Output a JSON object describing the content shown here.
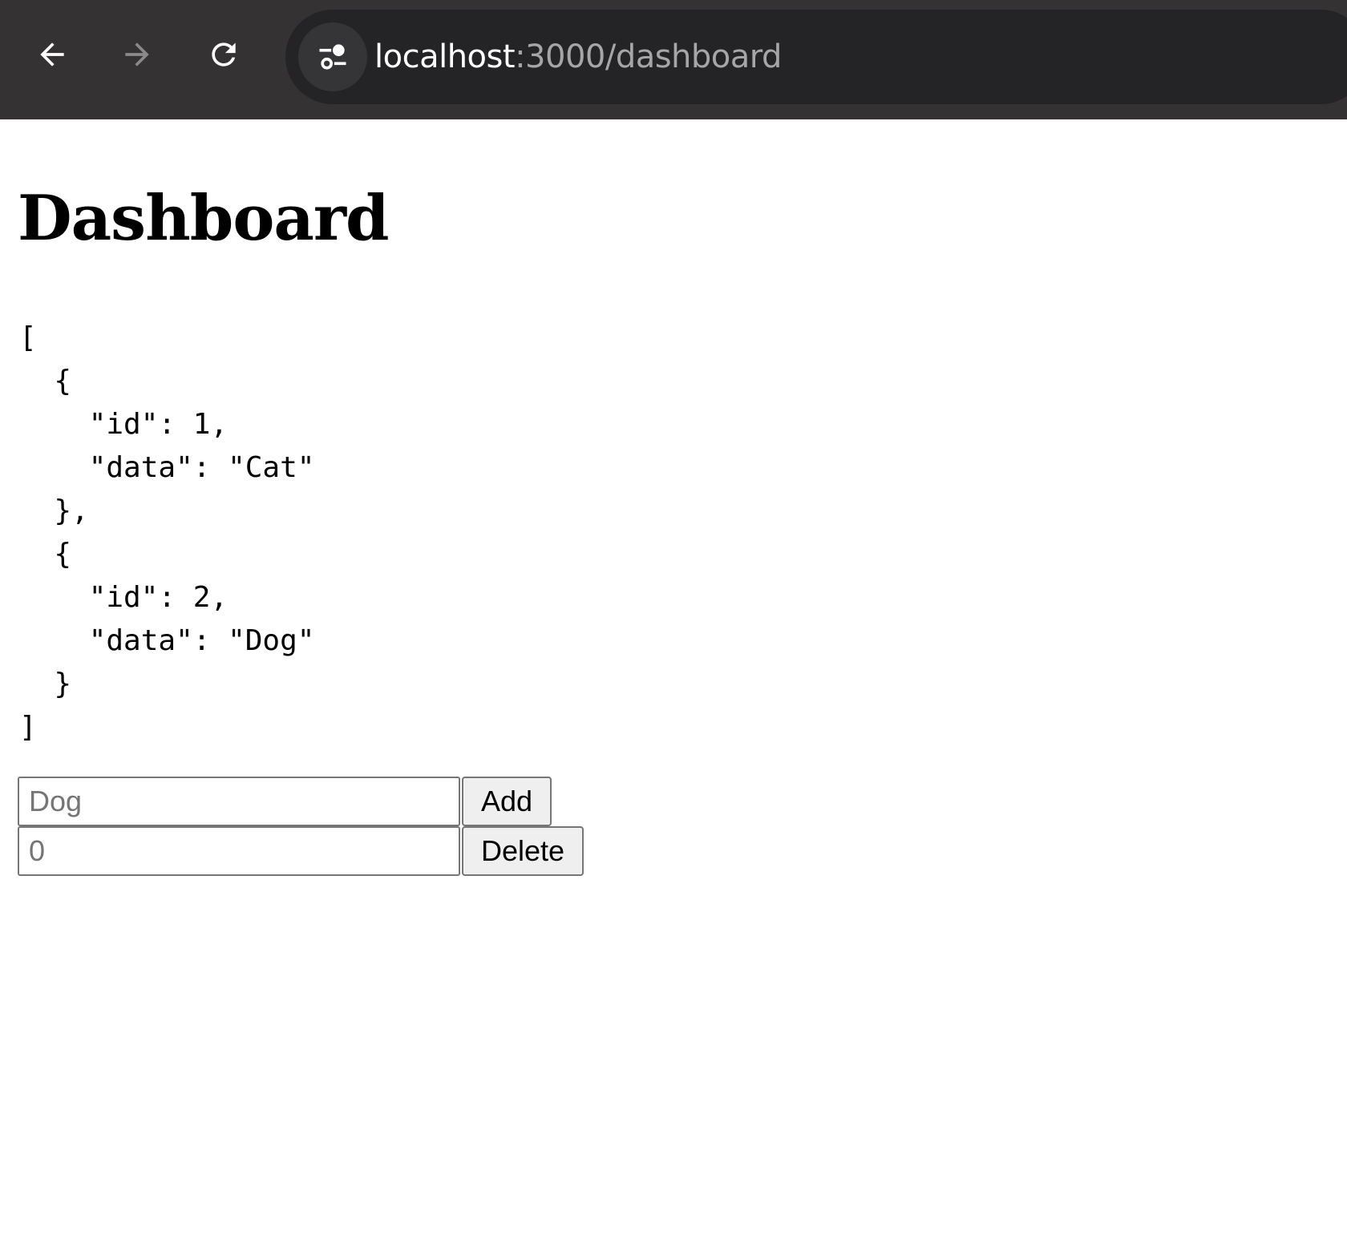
{
  "browser": {
    "url_host": "localhost",
    "url_path": ":3000/dashboard",
    "icons": {
      "back": "arrow-left-icon",
      "forward": "arrow-right-icon",
      "reload": "reload-icon",
      "site_info": "tune-icon"
    },
    "colors": {
      "chrome_bg": "#353233",
      "omnibox_bg": "#242426",
      "url_host": "#ffffff",
      "url_path": "#a6a6a8"
    }
  },
  "page": {
    "title": "Dashboard",
    "json_text": "[\n  {\n    \"id\": 1,\n    \"data\": \"Cat\"\n  },\n  {\n    \"id\": 2,\n    \"data\": \"Dog\"\n  }\n]",
    "add_form": {
      "placeholder": "Dog",
      "value": "",
      "button_label": "Add"
    },
    "delete_form": {
      "placeholder": "0",
      "value": "",
      "button_label": "Delete"
    }
  }
}
